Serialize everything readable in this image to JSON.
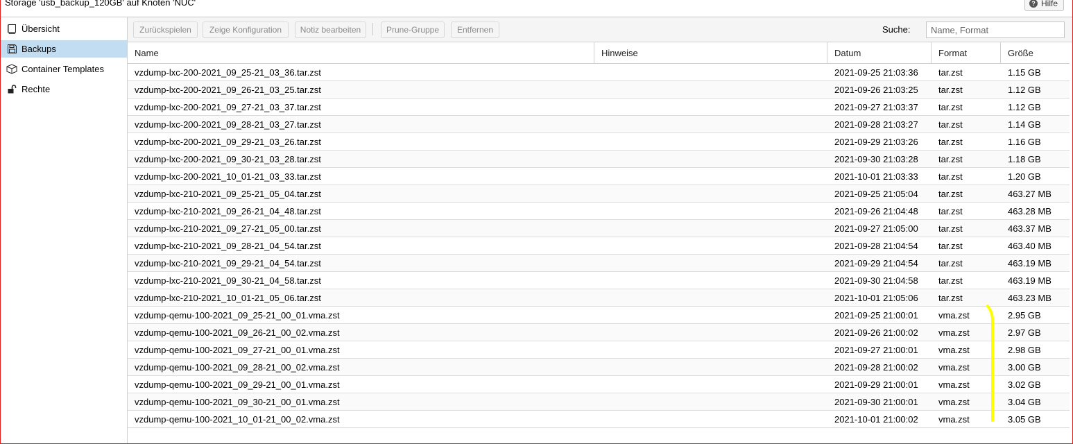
{
  "window": {
    "title": "Storage 'usb_backup_120GB' auf Knoten 'NUC'",
    "help_label": "Hilfe"
  },
  "sidebar": {
    "items": [
      {
        "label": "Übersicht",
        "icon": "book-icon",
        "active": false
      },
      {
        "label": "Backups",
        "icon": "floppy-disk-icon",
        "active": true
      },
      {
        "label": "Container Templates",
        "icon": "cube-icon",
        "active": false
      },
      {
        "label": "Rechte",
        "icon": "unlock-icon",
        "active": false
      }
    ]
  },
  "toolbar": {
    "restore_label": "Zurückspielen",
    "show_config_label": "Zeige Konfiguration",
    "edit_notes_label": "Notiz bearbeiten",
    "prune_label": "Prune-Gruppe",
    "remove_label": "Entfernen",
    "search_label": "Suche:",
    "search_placeholder": "Name, Format"
  },
  "table": {
    "columns": [
      "Name",
      "Hinweise",
      "Datum",
      "Format",
      "Größe"
    ],
    "rows": [
      {
        "name": "vzdump-lxc-200-2021_09_25-21_03_36.tar.zst",
        "notes": "",
        "date": "2021-09-25 21:03:36",
        "format": "tar.zst",
        "size": "1.15 GB"
      },
      {
        "name": "vzdump-lxc-200-2021_09_26-21_03_25.tar.zst",
        "notes": "",
        "date": "2021-09-26 21:03:25",
        "format": "tar.zst",
        "size": "1.12 GB"
      },
      {
        "name": "vzdump-lxc-200-2021_09_27-21_03_37.tar.zst",
        "notes": "",
        "date": "2021-09-27 21:03:37",
        "format": "tar.zst",
        "size": "1.12 GB"
      },
      {
        "name": "vzdump-lxc-200-2021_09_28-21_03_27.tar.zst",
        "notes": "",
        "date": "2021-09-28 21:03:27",
        "format": "tar.zst",
        "size": "1.14 GB"
      },
      {
        "name": "vzdump-lxc-200-2021_09_29-21_03_26.tar.zst",
        "notes": "",
        "date": "2021-09-29 21:03:26",
        "format": "tar.zst",
        "size": "1.16 GB"
      },
      {
        "name": "vzdump-lxc-200-2021_09_30-21_03_28.tar.zst",
        "notes": "",
        "date": "2021-09-30 21:03:28",
        "format": "tar.zst",
        "size": "1.18 GB"
      },
      {
        "name": "vzdump-lxc-200-2021_10_01-21_03_33.tar.zst",
        "notes": "",
        "date": "2021-10-01 21:03:33",
        "format": "tar.zst",
        "size": "1.20 GB"
      },
      {
        "name": "vzdump-lxc-210-2021_09_25-21_05_04.tar.zst",
        "notes": "",
        "date": "2021-09-25 21:05:04",
        "format": "tar.zst",
        "size": "463.27 MB"
      },
      {
        "name": "vzdump-lxc-210-2021_09_26-21_04_48.tar.zst",
        "notes": "",
        "date": "2021-09-26 21:04:48",
        "format": "tar.zst",
        "size": "463.28 MB"
      },
      {
        "name": "vzdump-lxc-210-2021_09_27-21_05_00.tar.zst",
        "notes": "",
        "date": "2021-09-27 21:05:00",
        "format": "tar.zst",
        "size": "463.37 MB"
      },
      {
        "name": "vzdump-lxc-210-2021_09_28-21_04_54.tar.zst",
        "notes": "",
        "date": "2021-09-28 21:04:54",
        "format": "tar.zst",
        "size": "463.40 MB"
      },
      {
        "name": "vzdump-lxc-210-2021_09_29-21_04_54.tar.zst",
        "notes": "",
        "date": "2021-09-29 21:04:54",
        "format": "tar.zst",
        "size": "463.19 MB"
      },
      {
        "name": "vzdump-lxc-210-2021_09_30-21_04_58.tar.zst",
        "notes": "",
        "date": "2021-09-30 21:04:58",
        "format": "tar.zst",
        "size": "463.19 MB"
      },
      {
        "name": "vzdump-lxc-210-2021_10_01-21_05_06.tar.zst",
        "notes": "",
        "date": "2021-10-01 21:05:06",
        "format": "tar.zst",
        "size": "463.23 MB"
      },
      {
        "name": "vzdump-qemu-100-2021_09_25-21_00_01.vma.zst",
        "notes": "",
        "date": "2021-09-25 21:00:01",
        "format": "vma.zst",
        "size": "2.95 GB"
      },
      {
        "name": "vzdump-qemu-100-2021_09_26-21_00_02.vma.zst",
        "notes": "",
        "date": "2021-09-26 21:00:02",
        "format": "vma.zst",
        "size": "2.97 GB"
      },
      {
        "name": "vzdump-qemu-100-2021_09_27-21_00_01.vma.zst",
        "notes": "",
        "date": "2021-09-27 21:00:01",
        "format": "vma.zst",
        "size": "2.98 GB"
      },
      {
        "name": "vzdump-qemu-100-2021_09_28-21_00_02.vma.zst",
        "notes": "",
        "date": "2021-09-28 21:00:02",
        "format": "vma.zst",
        "size": "3.00 GB"
      },
      {
        "name": "vzdump-qemu-100-2021_09_29-21_00_01.vma.zst",
        "notes": "",
        "date": "2021-09-29 21:00:01",
        "format": "vma.zst",
        "size": "3.02 GB"
      },
      {
        "name": "vzdump-qemu-100-2021_09_30-21_00_01.vma.zst",
        "notes": "",
        "date": "2021-09-30 21:00:01",
        "format": "vma.zst",
        "size": "3.04 GB"
      },
      {
        "name": "vzdump-qemu-100-2021_10_01-21_00_02.vma.zst",
        "notes": "",
        "date": "2021-10-01 21:00:02",
        "format": "vma.zst",
        "size": "3.05 GB"
      }
    ]
  },
  "colors": {
    "selection": "#c2ddf2",
    "frame": "#e21b1b",
    "highlighter": "#ffff00"
  }
}
